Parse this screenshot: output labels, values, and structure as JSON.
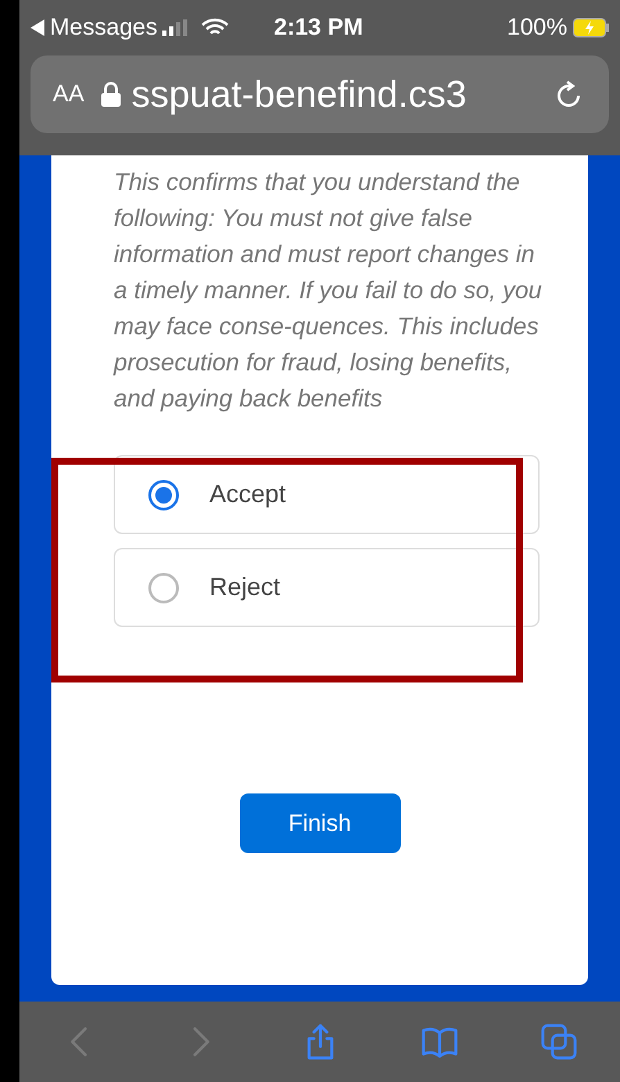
{
  "status_bar": {
    "back_app": "Messages",
    "time": "2:13 PM",
    "battery": "100%"
  },
  "address_bar": {
    "text_size": "AA",
    "url": "sspuat-benefind.cs3"
  },
  "consent": {
    "text": "This confirms that you understand the following: You must not give false information and must report changes in a timely manner. If you fail to do so, you may face conse-quences. This includes prosecution for fraud, losing benefits, and paying back benefits"
  },
  "options": [
    {
      "label": "Accept",
      "selected": true
    },
    {
      "label": "Reject",
      "selected": false
    }
  ],
  "finish_button": "Finish",
  "toolbar": [
    {
      "kind": "back",
      "disabled": true
    },
    {
      "kind": "forward",
      "disabled": true
    },
    {
      "kind": "share",
      "disabled": false
    },
    {
      "kind": "bookmarks",
      "disabled": false
    },
    {
      "kind": "tabs",
      "disabled": false
    }
  ]
}
